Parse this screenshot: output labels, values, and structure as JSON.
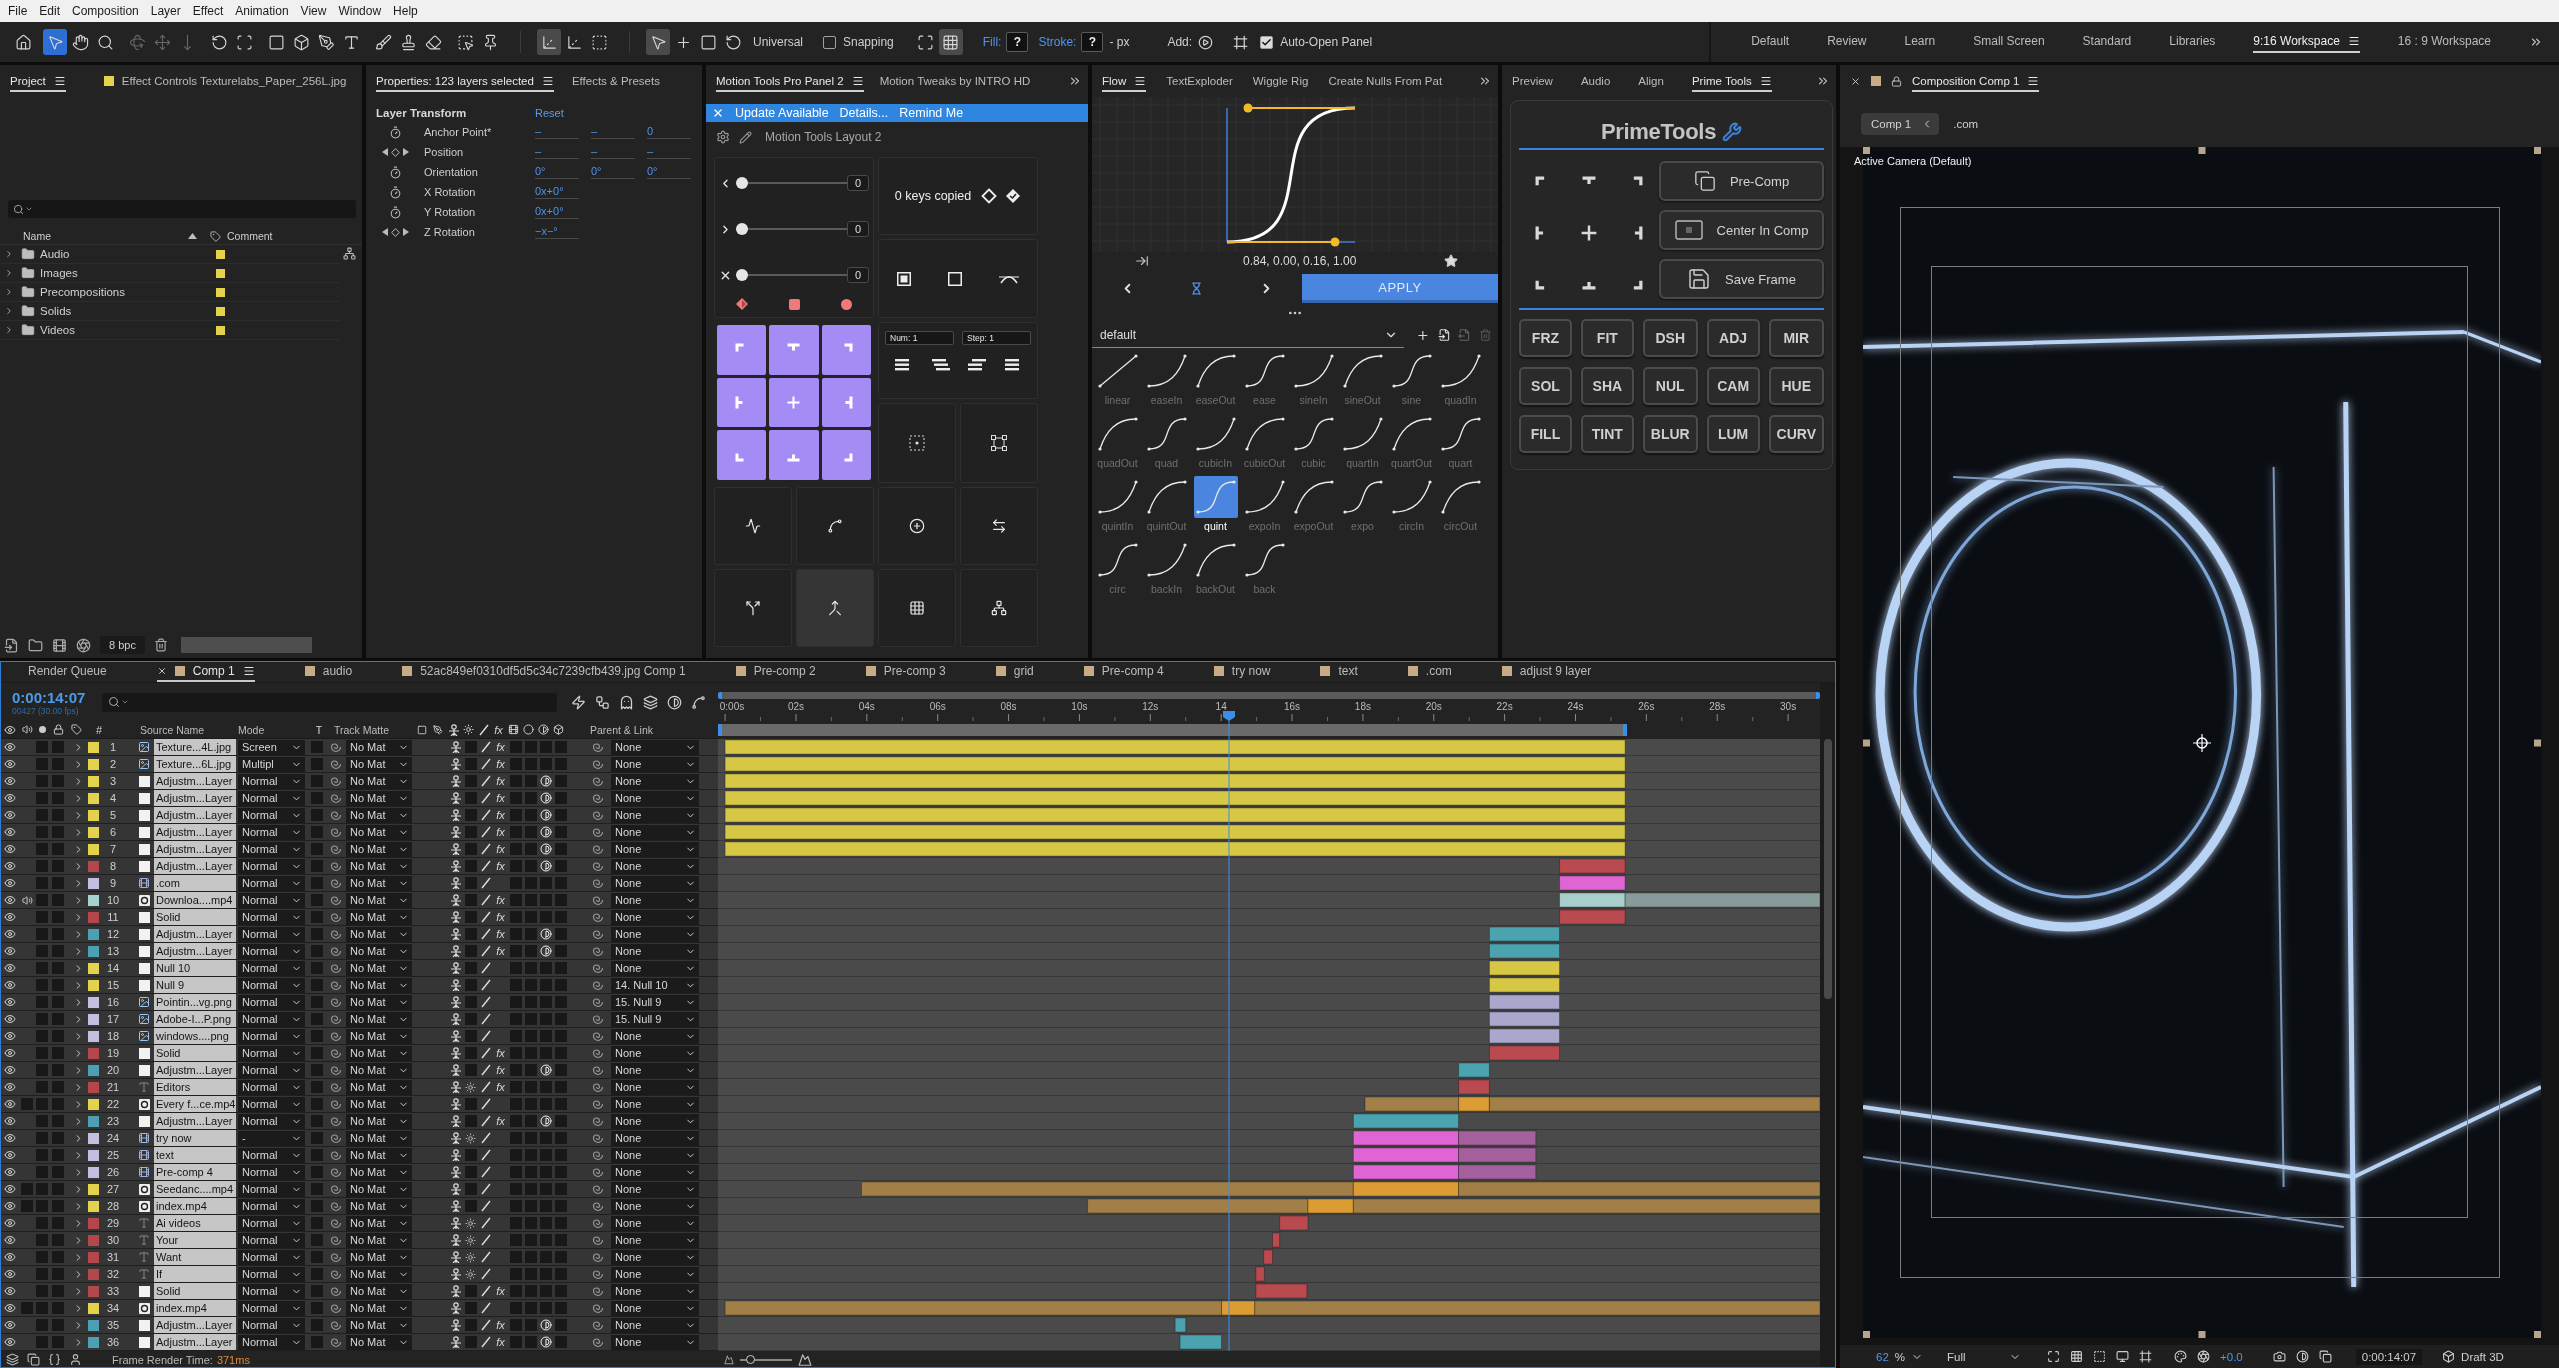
{
  "menu_bar": {
    "items": [
      "File",
      "Edit",
      "Composition",
      "Layer",
      "Effect",
      "Animation",
      "View",
      "Window",
      "Help"
    ]
  },
  "toolbar": {
    "tool_groups": [
      [
        {
          "kind": "home",
          "selected": false,
          "disabled": false
        }
      ],
      [
        {
          "kind": "select",
          "selected": true,
          "disabled": false
        },
        {
          "kind": "hand",
          "selected": false,
          "disabled": false
        },
        {
          "kind": "zoom",
          "selected": false,
          "disabled": false
        }
      ],
      [
        {
          "kind": "orbit",
          "selected": false,
          "disabled": true
        },
        {
          "kind": "pan",
          "selected": false,
          "disabled": true
        },
        {
          "kind": "dolly",
          "selected": false,
          "disabled": true
        }
      ],
      [
        {
          "kind": "rotate",
          "selected": false,
          "disabled": false
        },
        {
          "kind": "region",
          "selected": false,
          "disabled": false
        }
      ],
      [
        {
          "kind": "rectangle",
          "selected": false,
          "disabled": false
        },
        {
          "kind": "cube",
          "selected": false,
          "disabled": false
        },
        {
          "kind": "pen",
          "selected": false,
          "disabled": false
        },
        {
          "kind": "type",
          "selected": false,
          "disabled": false
        }
      ],
      [
        {
          "kind": "brush",
          "selected": false,
          "disabled": false
        },
        {
          "kind": "stamp",
          "selected": false,
          "disabled": false
        },
        {
          "kind": "eraser",
          "selected": false,
          "disabled": false
        }
      ],
      [
        {
          "kind": "roto",
          "selected": false,
          "disabled": false
        },
        {
          "kind": "pin",
          "selected": false,
          "disabled": false
        }
      ]
    ],
    "axis_modes": [
      {
        "kind": "local",
        "selected": true
      },
      {
        "kind": "world",
        "selected": false
      },
      {
        "kind": "view",
        "selected": false
      }
    ],
    "transform_tools": [
      {
        "kind": "select",
        "selected": true
      },
      {
        "kind": "move",
        "selected": false
      },
      {
        "kind": "scale",
        "selected": false
      },
      {
        "kind": "rotate",
        "selected": false
      }
    ],
    "transform_mode": "Universal",
    "snapping": {
      "label": "Snapping",
      "checked": false
    },
    "snap_options": [
      {
        "kind": "extend",
        "selected": false
      },
      {
        "kind": "grid",
        "selected": true
      }
    ],
    "fill": {
      "label": "Fill:",
      "value": "?"
    },
    "stroke": {
      "label": "Stroke:",
      "value": "?",
      "unit": "- px"
    },
    "add": {
      "label": "Add:"
    },
    "auto_open": {
      "label": "Auto-Open Panel",
      "checked": true
    },
    "workspaces": [
      {
        "label": "Default",
        "selected": false
      },
      {
        "label": "Review",
        "selected": false
      },
      {
        "label": "Learn",
        "selected": false
      },
      {
        "label": "Small Screen",
        "selected": false
      },
      {
        "label": "Standard",
        "selected": false
      },
      {
        "label": "Libraries",
        "selected": false
      },
      {
        "label": "9:16 Workspace",
        "selected": true
      },
      {
        "label": "16 : 9 Workspace",
        "selected": false
      }
    ]
  },
  "project_panel": {
    "tabs": [
      {
        "kind": "panel",
        "label": "Project",
        "selected": true
      },
      {
        "kind": "layer",
        "label": "Effect Controls Texturelabs_Paper_256L.jpg",
        "selected": false
      }
    ],
    "columns": {
      "name": "Name",
      "comment": "Comment"
    },
    "items": [
      {
        "name": "Audio",
        "expanded": false
      },
      {
        "name": "Images",
        "expanded": false
      },
      {
        "name": "Precompositions",
        "expanded": false
      },
      {
        "name": "Solids",
        "expanded": false
      },
      {
        "name": "Videos",
        "expanded": false
      }
    ],
    "bit_depth": "8 bpc"
  },
  "properties_panel": {
    "tabs": [
      {
        "label": "Properties: 123 layers selected",
        "selected": true
      },
      {
        "label": "Effects & Presets",
        "selected": false
      }
    ],
    "section": "Layer Transform",
    "reset": "Reset",
    "rows": [
      {
        "kind": "stopwatch",
        "label": "Anchor Point*",
        "values": [
          "–",
          "–",
          "0"
        ]
      },
      {
        "kind": "keyframes",
        "label": "Position",
        "values": [
          "–",
          "–",
          "–"
        ]
      },
      {
        "kind": "stopwatch",
        "label": "Orientation",
        "values": [
          "0°",
          "0°",
          "0°"
        ]
      },
      {
        "kind": "stopwatch",
        "label": "X Rotation",
        "values": [
          "0x+0°"
        ]
      },
      {
        "kind": "stopwatch",
        "label": "Y Rotation",
        "values": [
          "0x+0°"
        ]
      },
      {
        "kind": "keyframes",
        "label": "Z Rotation",
        "values": [
          "−x−°"
        ]
      }
    ]
  },
  "motion_tools_panel": {
    "tabs": [
      {
        "label": "Motion Tools Pro Panel 2",
        "selected": true
      },
      {
        "label": "Motion Tweaks by INTRO HD",
        "selected": false
      }
    ],
    "banner": {
      "message": "Update Available",
      "links": [
        "Details...",
        "Remind Me"
      ]
    },
    "layout_name": "Motion Tools Layout 2",
    "sliders": [
      {
        "kind": "ease-in",
        "level": 0,
        "value": "0"
      },
      {
        "kind": "ease-out",
        "level": 0,
        "value": "0"
      },
      {
        "kind": "both",
        "level": 0,
        "value": "0"
      }
    ],
    "keys_copied": "0 keys copied",
    "num_field": "Num: 1",
    "step_field": "Step: 1",
    "tool_cells": [
      {
        "kind": "wiggle",
        "highlighted": false
      },
      {
        "kind": "bounce",
        "highlighted": false
      },
      {
        "kind": "add",
        "highlighted": false
      },
      {
        "kind": "swap",
        "highlighted": false
      },
      {
        "kind": "split",
        "highlighted": false
      },
      {
        "kind": "merge",
        "highlighted": true
      },
      {
        "kind": "grid",
        "highlighted": false
      },
      {
        "kind": "connect",
        "highlighted": false
      }
    ]
  },
  "flow_panel": {
    "tabs": [
      {
        "label": "Flow",
        "selected": true
      },
      {
        "label": "TextExploder",
        "selected": false
      },
      {
        "label": "Wiggle Rig",
        "selected": false
      },
      {
        "label": "Create Nulls From Pat",
        "selected": false
      }
    ],
    "curve_values": "0.84, 0.00, 0.16, 1.00",
    "apply": "APPLY",
    "preset_set": "default",
    "presets": [
      {
        "label": "linear",
        "kind": "linear",
        "selected": false
      },
      {
        "label": "easeIn",
        "kind": "in",
        "selected": false
      },
      {
        "label": "easeOut",
        "kind": "out",
        "selected": false
      },
      {
        "label": "ease",
        "kind": "in-out",
        "selected": false
      },
      {
        "label": "sineIn",
        "kind": "in",
        "selected": false
      },
      {
        "label": "sineOut",
        "kind": "out",
        "selected": false
      },
      {
        "label": "sine",
        "kind": "in-out",
        "selected": false
      },
      {
        "label": "quadIn",
        "kind": "in",
        "selected": false
      },
      {
        "label": "quadOut",
        "kind": "out",
        "selected": false
      },
      {
        "label": "quad",
        "kind": "in-out",
        "selected": false
      },
      {
        "label": "cubicIn",
        "kind": "in",
        "selected": false
      },
      {
        "label": "cubicOut",
        "kind": "out",
        "selected": false
      },
      {
        "label": "cubic",
        "kind": "in-out",
        "selected": false
      },
      {
        "label": "quartIn",
        "kind": "in",
        "selected": false
      },
      {
        "label": "quartOut",
        "kind": "out",
        "selected": false
      },
      {
        "label": "quart",
        "kind": "in-out",
        "selected": false
      },
      {
        "label": "quintIn",
        "kind": "in",
        "selected": false
      },
      {
        "label": "quintOut",
        "kind": "out",
        "selected": false
      },
      {
        "label": "quint",
        "kind": "in-out",
        "selected": true
      },
      {
        "label": "expoIn",
        "kind": "in",
        "selected": false
      },
      {
        "label": "expoOut",
        "kind": "out",
        "selected": false
      },
      {
        "label": "expo",
        "kind": "in-out",
        "selected": false
      },
      {
        "label": "circIn",
        "kind": "in",
        "selected": false
      },
      {
        "label": "circOut",
        "kind": "out",
        "selected": false
      },
      {
        "label": "circ",
        "kind": "in-out",
        "selected": false
      },
      {
        "label": "backIn",
        "kind": "in",
        "selected": false
      },
      {
        "label": "backOut",
        "kind": "out",
        "selected": false
      },
      {
        "label": "back",
        "kind": "in-out",
        "selected": false
      }
    ]
  },
  "prime_panel": {
    "tabs": [
      {
        "label": "Preview",
        "selected": false
      },
      {
        "label": "Audio",
        "selected": false
      },
      {
        "label": "Align",
        "selected": false
      },
      {
        "label": "Prime Tools",
        "selected": true
      }
    ],
    "title": "PrimeTools",
    "actions": [
      {
        "kind": "precomp",
        "label": "Pre-Comp"
      },
      {
        "kind": "center",
        "label": "Center In Comp"
      },
      {
        "kind": "save",
        "label": "Save Frame"
      }
    ],
    "buttons": [
      "FRZ",
      "FIT",
      "DSH",
      "ADJ",
      "MIR",
      "SOL",
      "SHA",
      "NUL",
      "CAM",
      "HUE",
      "FILL",
      "TINT",
      "BLUR",
      "LUM",
      "CURV"
    ]
  },
  "viewer": {
    "tab": {
      "label": "Composition Comp 1"
    },
    "breadcrumbs": [
      {
        "label": "Comp 1",
        "selected": true
      },
      {
        "label": ".com",
        "selected": false
      }
    ],
    "camera": "Active Camera (Default)",
    "zoom": {
      "value": "62",
      "unit": "%"
    },
    "resolution": "Full",
    "exposure": "+0.0",
    "timecode": "0:00:14:07",
    "renderer": "Draft 3D"
  },
  "timeline": {
    "tabs": [
      {
        "kind": "queue",
        "label": "Render Queue",
        "selected": false
      },
      {
        "kind": "comp",
        "label": "Comp 1",
        "selected": true
      },
      {
        "kind": "comp",
        "label": "audio",
        "selected": false
      },
      {
        "kind": "comp",
        "label": "52ac849ef0310df5d5c34c7239cfb439.jpg Comp 1",
        "selected": false
      },
      {
        "kind": "comp",
        "label": "Pre-comp 2",
        "selected": false
      },
      {
        "kind": "comp",
        "label": "Pre-comp 3",
        "selected": false
      },
      {
        "kind": "comp",
        "label": "grid",
        "selected": false
      },
      {
        "kind": "comp",
        "label": "Pre-comp 4",
        "selected": false
      },
      {
        "kind": "comp",
        "label": "try now",
        "selected": false
      },
      {
        "kind": "comp",
        "label": "text",
        "selected": false
      },
      {
        "kind": "comp",
        "label": ".com",
        "selected": false
      },
      {
        "kind": "comp",
        "label": "adjust 9 layer",
        "selected": false
      }
    ],
    "timecode": "0:00:14:07",
    "frame_info": "00427 (30.00 fps)",
    "columns": {
      "number": "#",
      "source_name": "Source Name",
      "mode": "Mode",
      "t": "T",
      "track_matte": "Track Matte",
      "fx": "fx",
      "parent": "Parent & Link"
    },
    "layers": [
      {
        "number": "1",
        "name": "Texture...4L.jpg",
        "kind": "image",
        "mode": "Screen",
        "matte": "No Mat",
        "parent": "None",
        "color": "#e3d34a",
        "selected": true,
        "audio": false,
        "collapse": false,
        "adjustment": false,
        "fx": "fx"
      },
      {
        "number": "2",
        "name": "Texture...6L.jpg",
        "kind": "image",
        "mode": "Multipl",
        "matte": "No Mat",
        "parent": "None",
        "color": "#e3d34a",
        "selected": true,
        "audio": false,
        "collapse": false,
        "adjustment": false,
        "fx": "fx"
      },
      {
        "number": "3",
        "name": "Adjustm...Layer",
        "kind": "solid",
        "mode": "Normal",
        "matte": "No Mat",
        "parent": "None",
        "color": "#e3d34a",
        "selected": true,
        "audio": false,
        "collapse": false,
        "adjustment": true,
        "fx": "fx"
      },
      {
        "number": "4",
        "name": "Adjustm...Layer",
        "kind": "solid",
        "mode": "Normal",
        "matte": "No Mat",
        "parent": "None",
        "color": "#e3d34a",
        "selected": true,
        "audio": false,
        "collapse": false,
        "adjustment": true,
        "fx": "fx"
      },
      {
        "number": "5",
        "name": "Adjustm...Layer",
        "kind": "solid",
        "mode": "Normal",
        "matte": "No Mat",
        "parent": "None",
        "color": "#e3d34a",
        "selected": true,
        "audio": false,
        "collapse": false,
        "adjustment": true,
        "fx": "fx"
      },
      {
        "number": "6",
        "name": "Adjustm...Layer",
        "kind": "solid",
        "mode": "Normal",
        "matte": "No Mat",
        "parent": "None",
        "color": "#e3d34a",
        "selected": true,
        "audio": false,
        "collapse": false,
        "adjustment": true,
        "fx": "fx"
      },
      {
        "number": "7",
        "name": "Adjustm...Layer",
        "kind": "solid",
        "mode": "Normal",
        "matte": "No Mat",
        "parent": "None",
        "color": "#e3d34a",
        "selected": true,
        "audio": false,
        "collapse": false,
        "adjustment": true,
        "fx": "fx"
      },
      {
        "number": "8",
        "name": "Adjustm...Layer",
        "kind": "solid",
        "mode": "Normal",
        "matte": "No Mat",
        "parent": "None",
        "color": "#b4474c",
        "selected": true,
        "audio": false,
        "collapse": false,
        "adjustment": true,
        "fx": "fx"
      },
      {
        "number": "9",
        "name": ".com",
        "kind": "comp",
        "mode": "Normal",
        "matte": "No Mat",
        "parent": "None",
        "color": "#c3bedf",
        "selected": true,
        "audio": false,
        "collapse": false,
        "adjustment": false
      },
      {
        "number": "10",
        "name": "Downloa....mp4",
        "kind": "video",
        "mode": "Normal",
        "matte": "No Mat",
        "parent": "None",
        "color": "#a6d2cf",
        "selected": true,
        "audio": true,
        "collapse": false,
        "adjustment": false,
        "fx": "fx"
      },
      {
        "number": "11",
        "name": "Solid",
        "kind": "solid",
        "mode": "Normal",
        "matte": "No Mat",
        "parent": "None",
        "color": "#b4474c",
        "selected": true,
        "audio": false,
        "collapse": false,
        "adjustment": false,
        "fx": "fx"
      },
      {
        "number": "12",
        "name": "Adjustm...Layer",
        "kind": "solid",
        "mode": "Normal",
        "matte": "No Mat",
        "parent": "None",
        "color": "#4d9fb4",
        "selected": true,
        "audio": false,
        "collapse": false,
        "adjustment": true,
        "fx": "fx"
      },
      {
        "number": "13",
        "name": "Adjustm...Layer",
        "kind": "solid",
        "mode": "Normal",
        "matte": "No Mat",
        "parent": "None",
        "color": "#4d9fb4",
        "selected": true,
        "audio": false,
        "collapse": false,
        "adjustment": true,
        "fx": "fx"
      },
      {
        "number": "14",
        "name": "Null 10",
        "kind": "solid",
        "mode": "Normal",
        "matte": "No Mat",
        "parent": "None",
        "color": "#e3d34a",
        "selected": true,
        "audio": false,
        "collapse": false,
        "adjustment": false
      },
      {
        "number": "15",
        "name": "Null 9",
        "kind": "solid",
        "mode": "Normal",
        "matte": "No Mat",
        "parent": "14. Null 10",
        "color": "#e3d34a",
        "selected": true,
        "audio": false,
        "collapse": false,
        "adjustment": false
      },
      {
        "number": "16",
        "name": "Pointin...vg.png",
        "kind": "image",
        "mode": "Normal",
        "matte": "No Mat",
        "parent": "15. Null 9",
        "color": "#c3bedf",
        "selected": true,
        "audio": false,
        "collapse": false,
        "adjustment": false
      },
      {
        "number": "17",
        "name": "Adobe-I...P.png",
        "kind": "image",
        "mode": "Normal",
        "matte": "No Mat",
        "parent": "15. Null 9",
        "color": "#c3bedf",
        "selected": true,
        "audio": false,
        "collapse": false,
        "adjustment": false
      },
      {
        "number": "18",
        "name": "windows....png",
        "kind": "image",
        "mode": "Normal",
        "matte": "No Mat",
        "parent": "None",
        "color": "#c3bedf",
        "selected": true,
        "audio": false,
        "collapse": false,
        "adjustment": false
      },
      {
        "number": "19",
        "name": "Solid",
        "kind": "solid",
        "mode": "Normal",
        "matte": "No Mat",
        "parent": "None",
        "color": "#b4474c",
        "selected": true,
        "audio": false,
        "collapse": false,
        "adjustment": false,
        "fx": "fx"
      },
      {
        "number": "20",
        "name": "Adjustm...Layer",
        "kind": "solid",
        "mode": "Normal",
        "matte": "No Mat",
        "parent": "None",
        "color": "#4d9fb4",
        "selected": true,
        "audio": false,
        "collapse": false,
        "adjustment": true,
        "fx": "fx"
      },
      {
        "number": "21",
        "name": "Editors",
        "kind": "text",
        "mode": "Normal",
        "matte": "No Mat",
        "parent": "None",
        "color": "#b4474c",
        "selected": true,
        "audio": false,
        "collapse": true,
        "adjustment": false,
        "fx": "fx"
      },
      {
        "number": "22",
        "name": "Every f...ce.mp4",
        "kind": "video",
        "mode": "Normal",
        "matte": "No Mat",
        "parent": "None",
        "color": "#e3d34a",
        "selected": true,
        "audio": false,
        "collapse": false,
        "adjustment": false
      },
      {
        "number": "23",
        "name": "Adjustm...Layer",
        "kind": "solid",
        "mode": "Normal",
        "matte": "No Mat",
        "parent": "None",
        "color": "#4d9fb4",
        "selected": true,
        "audio": false,
        "collapse": false,
        "adjustment": true,
        "fx": "fx"
      },
      {
        "number": "24",
        "name": "try now",
        "kind": "comp",
        "mode": "-",
        "matte": "No Mat",
        "parent": "None",
        "color": "#c3bedf",
        "selected": true,
        "audio": false,
        "collapse": true,
        "adjustment": false
      },
      {
        "number": "25",
        "name": "text",
        "kind": "comp",
        "mode": "Normal",
        "matte": "No Mat",
        "parent": "None",
        "color": "#c3bedf",
        "selected": true,
        "audio": false,
        "collapse": false,
        "adjustment": false
      },
      {
        "number": "26",
        "name": "Pre-comp 4",
        "kind": "comp",
        "mode": "Normal",
        "matte": "No Mat",
        "parent": "None",
        "color": "#c3bedf",
        "selected": true,
        "audio": false,
        "collapse": false,
        "adjustment": false
      },
      {
        "number": "27",
        "name": "Seedanc....mp4",
        "kind": "video",
        "mode": "Normal",
        "matte": "No Mat",
        "parent": "None",
        "color": "#e3d34a",
        "selected": true,
        "audio": false,
        "collapse": false,
        "adjustment": false
      },
      {
        "number": "28",
        "name": "index.mp4",
        "kind": "video",
        "mode": "Normal",
        "matte": "No Mat",
        "parent": "None",
        "color": "#e3d34a",
        "selected": true,
        "audio": false,
        "collapse": false,
        "adjustment": false
      },
      {
        "number": "29",
        "name": "Ai videos",
        "kind": "text",
        "mode": "Normal",
        "matte": "No Mat",
        "parent": "None",
        "color": "#b4474c",
        "selected": true,
        "audio": false,
        "collapse": true,
        "adjustment": false
      },
      {
        "number": "30",
        "name": "Your",
        "kind": "text",
        "mode": "Normal",
        "matte": "No Mat",
        "parent": "None",
        "color": "#b4474c",
        "selected": true,
        "audio": false,
        "collapse": true,
        "adjustment": false
      },
      {
        "number": "31",
        "name": "Want",
        "kind": "text",
        "mode": "Normal",
        "matte": "No Mat",
        "parent": "None",
        "color": "#b4474c",
        "selected": true,
        "audio": false,
        "collapse": true,
        "adjustment": false
      },
      {
        "number": "32",
        "name": "If",
        "kind": "text",
        "mode": "Normal",
        "matte": "No Mat",
        "parent": "None",
        "color": "#b4474c",
        "selected": true,
        "audio": false,
        "collapse": true,
        "adjustment": false
      },
      {
        "number": "33",
        "name": "Solid",
        "kind": "solid",
        "mode": "Normal",
        "matte": "No Mat",
        "parent": "None",
        "color": "#b4474c",
        "selected": true,
        "audio": false,
        "collapse": false,
        "adjustment": false,
        "fx": "fx"
      },
      {
        "number": "34",
        "name": "index.mp4",
        "kind": "video",
        "mode": "Normal",
        "matte": "No Mat",
        "parent": "None",
        "color": "#e3d34a",
        "selected": true,
        "audio": false,
        "collapse": false,
        "adjustment": false
      },
      {
        "number": "35",
        "name": "Adjustm...Layer",
        "kind": "solid",
        "mode": "Normal",
        "matte": "No Mat",
        "parent": "None",
        "color": "#4d9fb4",
        "selected": true,
        "audio": false,
        "collapse": false,
        "adjustment": true,
        "fx": "fx"
      },
      {
        "number": "36",
        "name": "Adjustm...Layer",
        "kind": "solid",
        "mode": "Normal",
        "matte": "No Mat",
        "parent": "None",
        "color": "#4d9fb4",
        "selected": true,
        "audio": false,
        "collapse": false,
        "adjustment": true,
        "fx": "fx"
      }
    ],
    "ruler_labels": [
      "0:00s",
      "02s",
      "04s",
      "06s",
      "08s",
      "10s",
      "12s",
      "14",
      "16s",
      "18s",
      "20s",
      "22s",
      "24s",
      "26s",
      "28s",
      "30s"
    ],
    "playhead": {
      "level": 0.464
    },
    "work_area": {
      "level": 0.825
    },
    "zoom_slider": {
      "level": 0.15
    },
    "render_time": {
      "label": "Frame Render Time:",
      "value": "371ms"
    }
  }
}
